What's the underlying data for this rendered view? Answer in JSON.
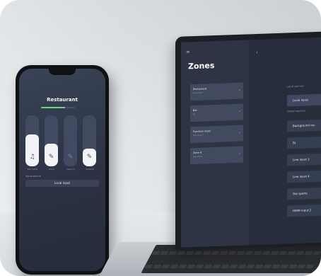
{
  "phone": {
    "title": "Restaurant",
    "progress": 0.7,
    "sliders": [
      {
        "level": 0.62,
        "icon": "music-note-icon",
        "glyph": "♫",
        "label": "Ppm output"
      },
      {
        "level": 0.45,
        "icon": "microphone-icon",
        "glyph": "✎",
        "label": "Line in"
      },
      {
        "level": 0.0,
        "icon": "microphone-icon",
        "glyph": "✎",
        "label": "Input mic"
      },
      {
        "level": 0.35,
        "icon": "microphone-icon",
        "glyph": "✎",
        "label": "Input mic"
      }
    ],
    "source_section": "Input source",
    "source_value": "Local input"
  },
  "laptop": {
    "zones_title": "Zones",
    "zones": [
      {
        "name": "Restaurant",
        "sub": "Local input"
      },
      {
        "name": "Bar",
        "sub": "Dj"
      },
      {
        "name": "Function room",
        "sub": "Line input 2"
      },
      {
        "name": "Zone 4",
        "sub": "Sky sports"
      }
    ],
    "local_sources_label": "Local sources",
    "local_source": "Local input",
    "global_sources_label": "Global sources",
    "global_sources": [
      "Background mu",
      "Dj",
      "Line input 3",
      "Line input 4",
      "Sky sports",
      "HDMI input 2"
    ]
  }
}
